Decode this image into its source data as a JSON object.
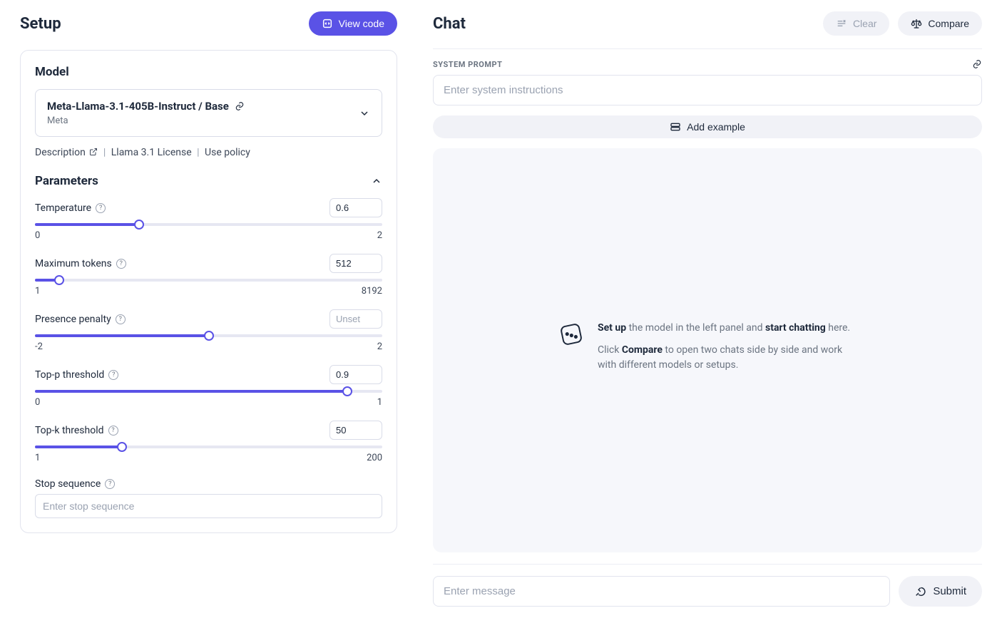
{
  "setup": {
    "title": "Setup",
    "view_code_label": "View code",
    "model_section_label": "Model",
    "model": {
      "name": "Meta-Llama-3.1-405B-Instruct / Base",
      "vendor": "Meta"
    },
    "meta_links": {
      "description": "Description",
      "license": "Llama 3.1 License",
      "use_policy": "Use policy"
    },
    "parameters_label": "Parameters",
    "parameters": {
      "temperature": {
        "label": "Temperature",
        "value": "0.6",
        "min": "0",
        "max": "2",
        "fill_pct": 30
      },
      "max_tokens": {
        "label": "Maximum tokens",
        "value": "512",
        "min": "1",
        "max": "8192",
        "fill_pct": 7
      },
      "presence_penalty": {
        "label": "Presence penalty",
        "value": "Unset",
        "min": "-2",
        "max": "2",
        "fill_pct": 50
      },
      "top_p": {
        "label": "Top-p threshold",
        "value": "0.9",
        "min": "0",
        "max": "1",
        "fill_pct": 90
      },
      "top_k": {
        "label": "Top-k threshold",
        "value": "50",
        "min": "1",
        "max": "200",
        "fill_pct": 25
      },
      "stop_sequence": {
        "label": "Stop sequence",
        "placeholder": "Enter stop sequence"
      }
    }
  },
  "chat": {
    "title": "Chat",
    "clear_label": "Clear",
    "compare_label": "Compare",
    "system_prompt_label": "SYSTEM PROMPT",
    "system_prompt_placeholder": "Enter system instructions",
    "add_example_label": "Add example",
    "empty": {
      "line1_strong": "Set up",
      "line1_rest": " the model in the left panel and ",
      "line1_strong2": "start chatting",
      "line1_tail": " here.",
      "line2_pre": "Click ",
      "line2_strong": "Compare",
      "line2_rest": " to open two chats side by side and work with different models or setups."
    },
    "message_placeholder": "Enter message",
    "submit_label": "Submit"
  }
}
